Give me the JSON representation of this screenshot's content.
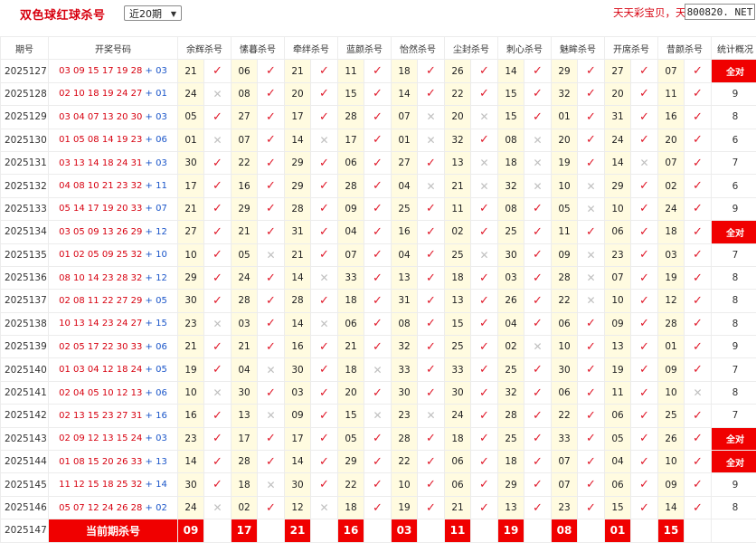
{
  "header": {
    "title": "双色球红球杀号",
    "period_select": "近20期",
    "promo": "天天彩宝贝，天",
    "site": "800820. NET"
  },
  "columns": [
    "期号",
    "开奖号码",
    "余辉杀号",
    "愫暮杀号",
    "牵绊杀号",
    "蓝颜杀号",
    "怡然杀号",
    "尘封杀号",
    "刺心杀号",
    "魅眸杀号",
    "开席杀号",
    "昔颜杀号",
    "统计概况"
  ],
  "rows": [
    {
      "issue": "2025127",
      "red": "03 09 15 17 19 28",
      "blue": "03",
      "picks": [
        [
          "21",
          1
        ],
        [
          "06",
          1
        ],
        [
          "21",
          1
        ],
        [
          "11",
          1
        ],
        [
          "18",
          1
        ],
        [
          "26",
          1
        ],
        [
          "14",
          1
        ],
        [
          "29",
          1
        ],
        [
          "27",
          1
        ],
        [
          "07",
          1
        ]
      ],
      "stat": "全对"
    },
    {
      "issue": "2025128",
      "red": "02 10 18 19 24 27",
      "blue": "01",
      "picks": [
        [
          "24",
          0
        ],
        [
          "08",
          1
        ],
        [
          "20",
          1
        ],
        [
          "15",
          1
        ],
        [
          "14",
          1
        ],
        [
          "22",
          1
        ],
        [
          "15",
          1
        ],
        [
          "32",
          1
        ],
        [
          "20",
          1
        ],
        [
          "11",
          1
        ]
      ],
      "stat": "9"
    },
    {
      "issue": "2025129",
      "red": "03 04 07 13 20 30",
      "blue": "03",
      "picks": [
        [
          "05",
          1
        ],
        [
          "27",
          1
        ],
        [
          "17",
          1
        ],
        [
          "28",
          1
        ],
        [
          "07",
          0
        ],
        [
          "20",
          0
        ],
        [
          "15",
          1
        ],
        [
          "01",
          1
        ],
        [
          "31",
          1
        ],
        [
          "16",
          1
        ]
      ],
      "stat": "8"
    },
    {
      "issue": "2025130",
      "red": "01 05 08 14 19 23",
      "blue": "06",
      "picks": [
        [
          "01",
          0
        ],
        [
          "07",
          1
        ],
        [
          "14",
          0
        ],
        [
          "17",
          1
        ],
        [
          "01",
          0
        ],
        [
          "32",
          1
        ],
        [
          "08",
          0
        ],
        [
          "20",
          1
        ],
        [
          "24",
          1
        ],
        [
          "20",
          1
        ]
      ],
      "stat": "6"
    },
    {
      "issue": "2025131",
      "red": "03 13 14 18 24 31",
      "blue": "03",
      "picks": [
        [
          "30",
          1
        ],
        [
          "22",
          1
        ],
        [
          "29",
          1
        ],
        [
          "06",
          1
        ],
        [
          "27",
          1
        ],
        [
          "13",
          0
        ],
        [
          "18",
          0
        ],
        [
          "19",
          1
        ],
        [
          "14",
          0
        ],
        [
          "07",
          1
        ]
      ],
      "stat": "7"
    },
    {
      "issue": "2025132",
      "red": "04 08 10 21 23 32",
      "blue": "11",
      "picks": [
        [
          "17",
          1
        ],
        [
          "16",
          1
        ],
        [
          "29",
          1
        ],
        [
          "28",
          1
        ],
        [
          "04",
          0
        ],
        [
          "21",
          0
        ],
        [
          "32",
          0
        ],
        [
          "10",
          0
        ],
        [
          "29",
          1
        ],
        [
          "02",
          1
        ]
      ],
      "stat": "6"
    },
    {
      "issue": "2025133",
      "red": "05 14 17 19 20 33",
      "blue": "07",
      "picks": [
        [
          "21",
          1
        ],
        [
          "29",
          1
        ],
        [
          "28",
          1
        ],
        [
          "09",
          1
        ],
        [
          "25",
          1
        ],
        [
          "11",
          1
        ],
        [
          "08",
          1
        ],
        [
          "05",
          0
        ],
        [
          "10",
          1
        ],
        [
          "24",
          1
        ]
      ],
      "stat": "9"
    },
    {
      "issue": "2025134",
      "red": "03 05 09 13 26 29",
      "blue": "12",
      "picks": [
        [
          "27",
          1
        ],
        [
          "21",
          1
        ],
        [
          "31",
          1
        ],
        [
          "04",
          1
        ],
        [
          "16",
          1
        ],
        [
          "02",
          1
        ],
        [
          "25",
          1
        ],
        [
          "11",
          1
        ],
        [
          "06",
          1
        ],
        [
          "18",
          1
        ]
      ],
      "stat": "全对"
    },
    {
      "issue": "2025135",
      "red": "01 02 05 09 25 32",
      "blue": "10",
      "picks": [
        [
          "10",
          1
        ],
        [
          "05",
          0
        ],
        [
          "21",
          1
        ],
        [
          "07",
          1
        ],
        [
          "04",
          1
        ],
        [
          "25",
          0
        ],
        [
          "30",
          1
        ],
        [
          "09",
          0
        ],
        [
          "23",
          1
        ],
        [
          "03",
          1
        ]
      ],
      "stat": "7"
    },
    {
      "issue": "2025136",
      "red": "08 10 14 23 28 32",
      "blue": "12",
      "picks": [
        [
          "29",
          1
        ],
        [
          "24",
          1
        ],
        [
          "14",
          0
        ],
        [
          "33",
          1
        ],
        [
          "13",
          1
        ],
        [
          "18",
          1
        ],
        [
          "03",
          1
        ],
        [
          "28",
          0
        ],
        [
          "07",
          1
        ],
        [
          "19",
          1
        ]
      ],
      "stat": "8"
    },
    {
      "issue": "2025137",
      "red": "02 08 11 22 27 29",
      "blue": "05",
      "picks": [
        [
          "30",
          1
        ],
        [
          "28",
          1
        ],
        [
          "28",
          1
        ],
        [
          "18",
          1
        ],
        [
          "31",
          1
        ],
        [
          "13",
          1
        ],
        [
          "26",
          1
        ],
        [
          "22",
          0
        ],
        [
          "10",
          1
        ],
        [
          "12",
          1
        ]
      ],
      "stat": "8"
    },
    {
      "issue": "2025138",
      "red": "10 13 14 23 24 27",
      "blue": "15",
      "picks": [
        [
          "23",
          0
        ],
        [
          "03",
          1
        ],
        [
          "14",
          0
        ],
        [
          "06",
          1
        ],
        [
          "08",
          1
        ],
        [
          "15",
          1
        ],
        [
          "04",
          1
        ],
        [
          "06",
          1
        ],
        [
          "09",
          1
        ],
        [
          "28",
          1
        ]
      ],
      "stat": "8"
    },
    {
      "issue": "2025139",
      "red": "02 05 17 22 30 33",
      "blue": "06",
      "picks": [
        [
          "21",
          1
        ],
        [
          "21",
          1
        ],
        [
          "16",
          1
        ],
        [
          "21",
          1
        ],
        [
          "32",
          1
        ],
        [
          "25",
          1
        ],
        [
          "02",
          0
        ],
        [
          "10",
          1
        ],
        [
          "13",
          1
        ],
        [
          "01",
          1
        ]
      ],
      "stat": "9"
    },
    {
      "issue": "2025140",
      "red": "01 03 04 12 18 24",
      "blue": "05",
      "picks": [
        [
          "19",
          1
        ],
        [
          "04",
          0
        ],
        [
          "30",
          1
        ],
        [
          "18",
          0
        ],
        [
          "33",
          1
        ],
        [
          "33",
          1
        ],
        [
          "25",
          1
        ],
        [
          "30",
          1
        ],
        [
          "19",
          1
        ],
        [
          "09",
          1
        ]
      ],
      "stat": "7"
    },
    {
      "issue": "2025141",
      "red": "02 04 05 10 12 13",
      "blue": "06",
      "picks": [
        [
          "10",
          0
        ],
        [
          "30",
          1
        ],
        [
          "03",
          1
        ],
        [
          "20",
          1
        ],
        [
          "30",
          1
        ],
        [
          "30",
          1
        ],
        [
          "32",
          1
        ],
        [
          "06",
          1
        ],
        [
          "11",
          1
        ],
        [
          "10",
          0
        ]
      ],
      "stat": "8"
    },
    {
      "issue": "2025142",
      "red": "02 13 15 23 27 31",
      "blue": "16",
      "picks": [
        [
          "16",
          1
        ],
        [
          "13",
          0
        ],
        [
          "09",
          1
        ],
        [
          "15",
          0
        ],
        [
          "23",
          0
        ],
        [
          "24",
          1
        ],
        [
          "28",
          1
        ],
        [
          "22",
          1
        ],
        [
          "06",
          1
        ],
        [
          "25",
          1
        ]
      ],
      "stat": "7"
    },
    {
      "issue": "2025143",
      "red": "02 09 12 13 15 24",
      "blue": "03",
      "picks": [
        [
          "23",
          1
        ],
        [
          "17",
          1
        ],
        [
          "17",
          1
        ],
        [
          "05",
          1
        ],
        [
          "28",
          1
        ],
        [
          "18",
          1
        ],
        [
          "25",
          1
        ],
        [
          "33",
          1
        ],
        [
          "05",
          1
        ],
        [
          "26",
          1
        ]
      ],
      "stat": "全对"
    },
    {
      "issue": "2025144",
      "red": "01 08 15 20 26 33",
      "blue": "13",
      "picks": [
        [
          "14",
          1
        ],
        [
          "28",
          1
        ],
        [
          "14",
          1
        ],
        [
          "29",
          1
        ],
        [
          "22",
          1
        ],
        [
          "06",
          1
        ],
        [
          "18",
          1
        ],
        [
          "07",
          1
        ],
        [
          "04",
          1
        ],
        [
          "10",
          1
        ]
      ],
      "stat": "全对"
    },
    {
      "issue": "2025145",
      "red": "11 12 15 18 25 32",
      "blue": "14",
      "picks": [
        [
          "30",
          1
        ],
        [
          "18",
          0
        ],
        [
          "30",
          1
        ],
        [
          "22",
          1
        ],
        [
          "10",
          1
        ],
        [
          "06",
          1
        ],
        [
          "29",
          1
        ],
        [
          "07",
          1
        ],
        [
          "06",
          1
        ],
        [
          "09",
          1
        ]
      ],
      "stat": "9"
    },
    {
      "issue": "2025146",
      "red": "05 07 12 24 26 28",
      "blue": "02",
      "picks": [
        [
          "24",
          0
        ],
        [
          "02",
          1
        ],
        [
          "12",
          0
        ],
        [
          "18",
          1
        ],
        [
          "19",
          1
        ],
        [
          "21",
          1
        ],
        [
          "13",
          1
        ],
        [
          "23",
          1
        ],
        [
          "15",
          1
        ],
        [
          "14",
          1
        ]
      ],
      "stat": "8"
    }
  ],
  "current": {
    "issue": "2025147",
    "label": "当前期杀号",
    "picks": [
      "09",
      "17",
      "21",
      "16",
      "03",
      "11",
      "19",
      "08",
      "01",
      "15"
    ]
  },
  "icons": {
    "correct": "check-icon",
    "wrong": "cross-icon"
  },
  "colors": {
    "accent": "#f00000",
    "check": "#e0192a",
    "number_bg": "#fffbe0",
    "blue_ball": "#1a55c9"
  }
}
